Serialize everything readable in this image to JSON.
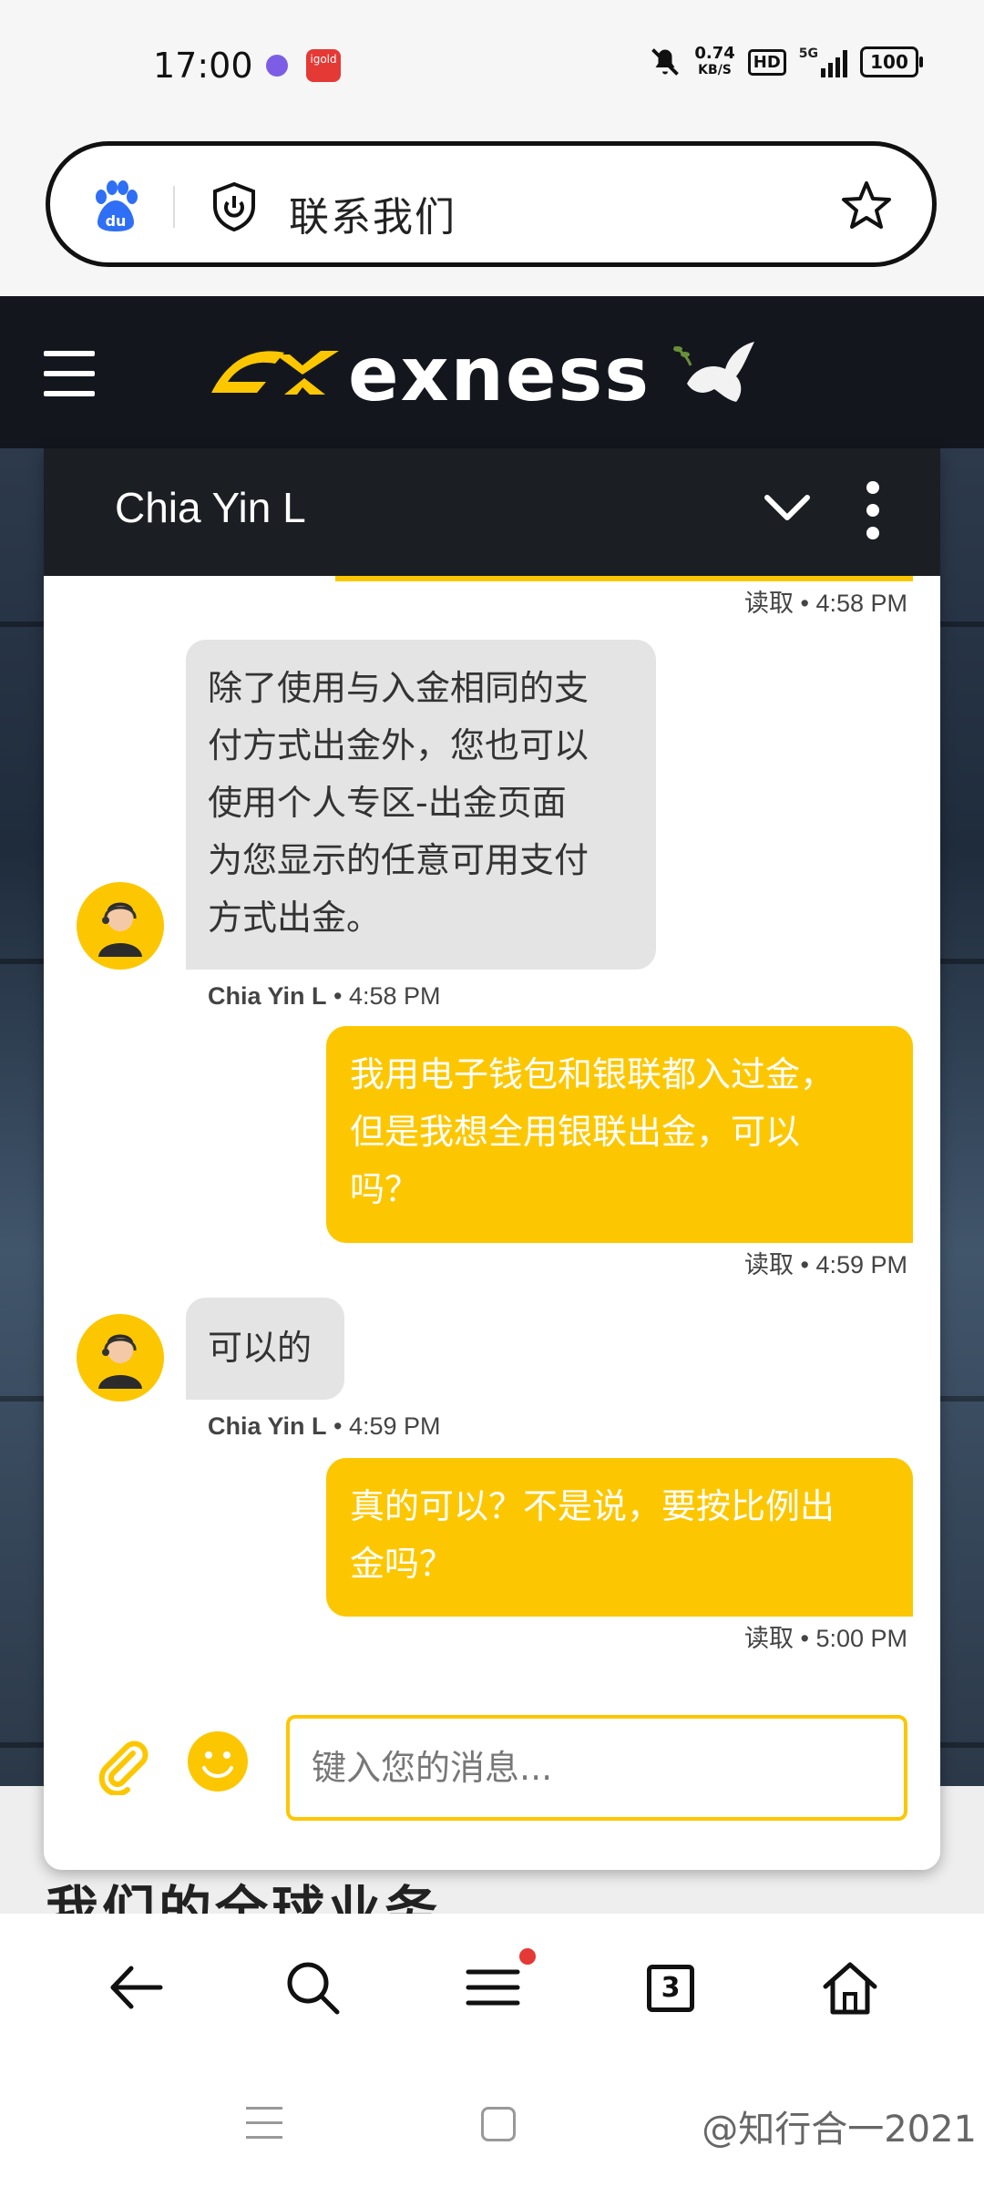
{
  "status_bar": {
    "time": "17:00",
    "app2_label": "igold",
    "net_speed_value": "0.74",
    "net_speed_unit": "KB/S",
    "hd_label": "HD",
    "signal_label": "5G",
    "battery": "100",
    "icons": [
      "notification-app-icon",
      "igold-app-icon",
      "mute-icon",
      "signal-icon",
      "battery-icon"
    ]
  },
  "address_bar": {
    "title": "联系我们",
    "icons": [
      "baidu-icon",
      "shield-icon",
      "bookmark-star-icon"
    ]
  },
  "site_header": {
    "brand": "exness",
    "icons": [
      "hamburger-menu-icon",
      "exness-logo-mark",
      "dove-icon"
    ]
  },
  "chat": {
    "agent_name": "Chia Yin L",
    "colors": {
      "accent": "#fcc700",
      "header": "#1b1f24",
      "agent_bubble": "#e4e4e4"
    },
    "messages": [
      {
        "from": "status",
        "meta_status": "读取",
        "meta_time": "4:58 PM"
      },
      {
        "from": "agent",
        "lines": [
          "除了使用与入金相同的支",
          "付方式出金外，您也可以",
          "使用个人专区-出金页面",
          "为您显示的任意可用支付",
          "方式出金。"
        ],
        "meta_name": "Chia Yin L",
        "meta_time": "4:58 PM"
      },
      {
        "from": "user",
        "lines": [
          "我用电子钱包和银联都入过金，",
          "但是我想全用银联出金，可以",
          "吗？"
        ],
        "meta_status": "读取",
        "meta_time": "4:59 PM"
      },
      {
        "from": "agent",
        "lines": [
          "可以的"
        ],
        "meta_name": "Chia Yin L",
        "meta_time": "4:59 PM"
      },
      {
        "from": "user",
        "lines": [
          "真的可以？不是说，要按比例出",
          "金吗？"
        ],
        "meta_status": "读取",
        "meta_time": "5:00 PM"
      }
    ],
    "composer_placeholder": "键入您的消息..."
  },
  "page_heading": "我们的全球业务",
  "browser_nav": {
    "tab_count": "3",
    "icons": [
      "back-arrow-icon",
      "search-icon",
      "menu-icon",
      "tabs-icon",
      "home-icon"
    ]
  },
  "watermark": "@知行合一2021"
}
